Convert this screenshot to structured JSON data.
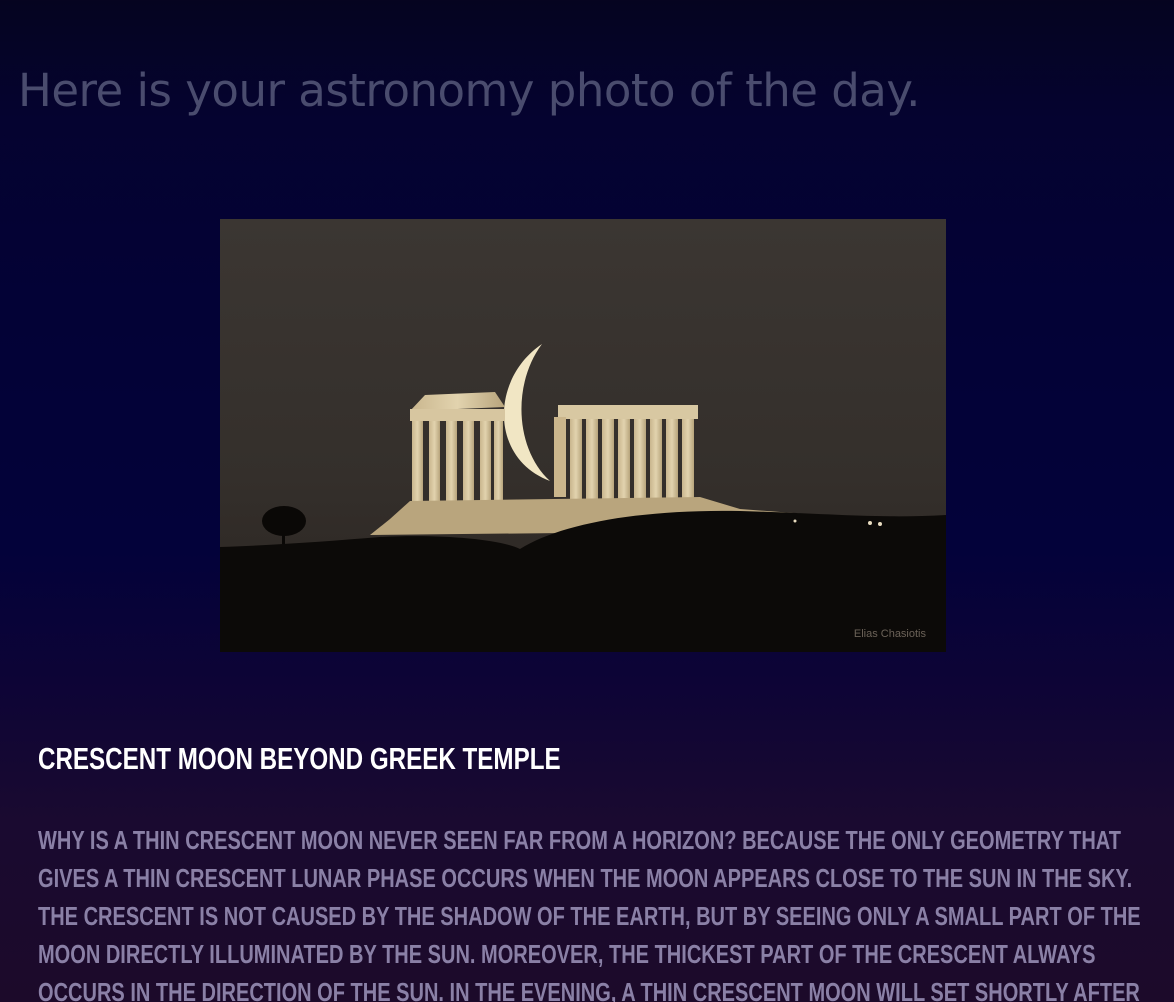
{
  "header": {
    "headline": "Here is your astronomy photo of the day."
  },
  "photo": {
    "credit": "Elias Chasiotis"
  },
  "caption": {
    "title": "Crescent Moon beyond Greek Temple",
    "body": "Why is a thin crescent moon never seen far from a horizon? Because the only geometry that gives a thin crescent lunar phase occurs when the Moon appears close to the Sun in the sky. The crescent is not caused by the shadow of the Earth, but by seeing only a small part of the Moon directly illuminated by the Sun. Moreover, the thickest part of the crescent always occurs in the direction of the Sun. In the evening, a thin crescent moon will set shortly after the Sun and not be seen for the rest of the night."
  },
  "colors": {
    "background_top": "#050420",
    "background_bottom": "#1c0a2a",
    "headline": "#4a4c6e",
    "title": "#ffffff",
    "body": "#8a80a6"
  }
}
